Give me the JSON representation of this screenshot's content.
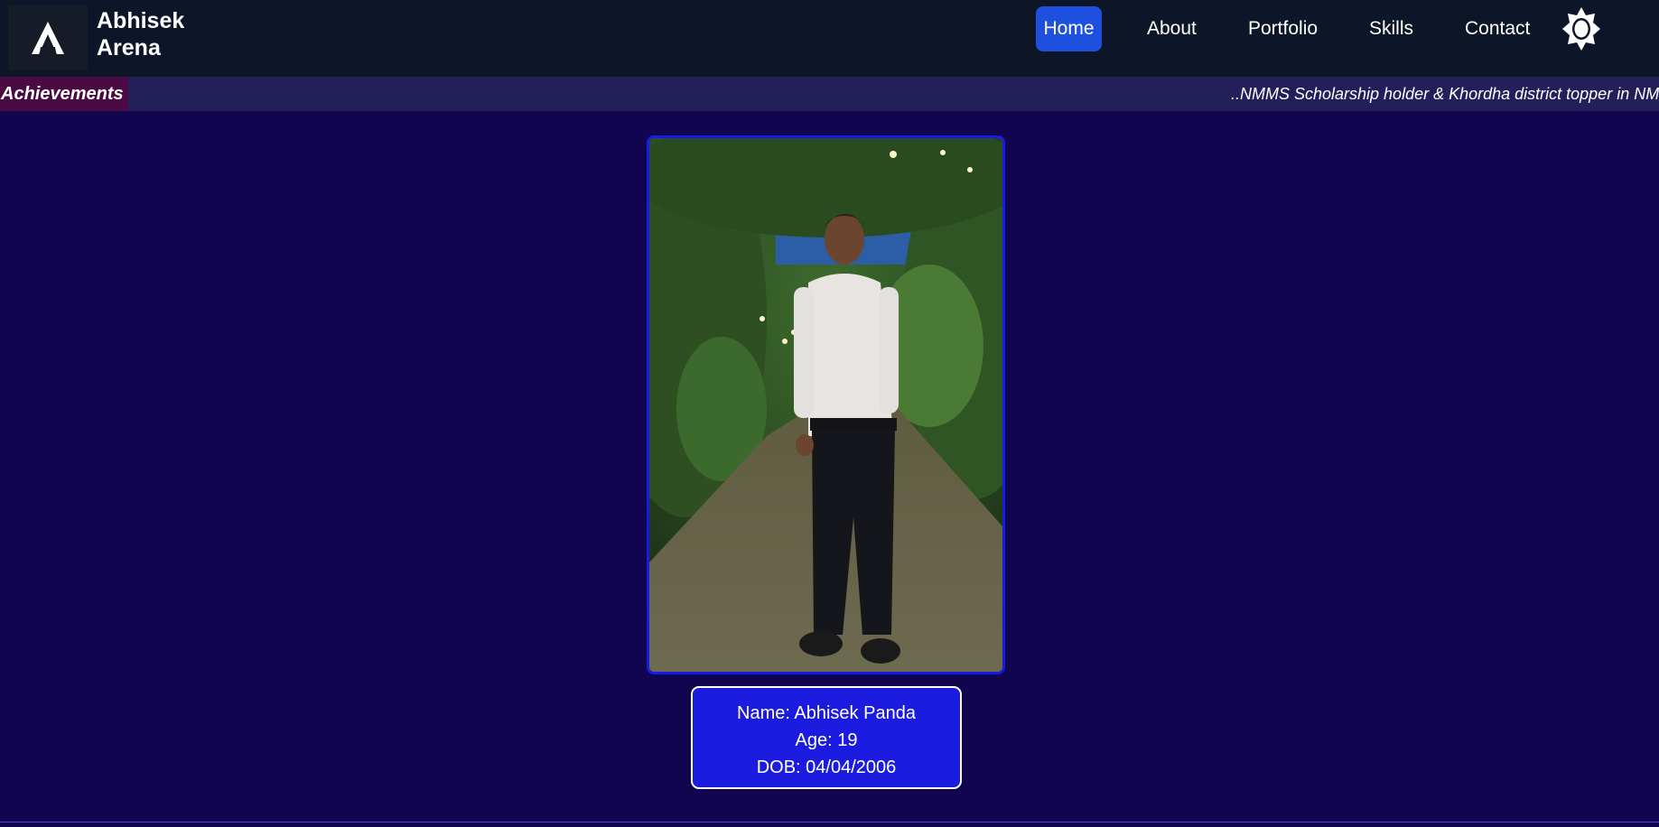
{
  "header": {
    "logo_letter": "A",
    "brand_line1": "Abhisek",
    "brand_line2": "Arena",
    "nav": [
      {
        "label": "Home",
        "active": true
      },
      {
        "label": "About"
      },
      {
        "label": "Portfolio"
      },
      {
        "label": "Skills"
      },
      {
        "label": "Contact"
      }
    ],
    "theme_icon": "sun-icon"
  },
  "ticker": {
    "label": "Achievements",
    "text": "..NMMS Scholarship holder & Khordha district topper in NMMS"
  },
  "profile": {
    "photo_icon": "profile-photo",
    "name_line": "Name: Abhisek Panda",
    "age_line": "Age: 19",
    "dob_line": "DOB: 04/04/2006"
  },
  "colors": {
    "page_bg": "#12054f",
    "header_bg": "#0d1628",
    "nav_active": "#1e50e0",
    "ticker_bg": "#231f5a",
    "ticker_label_bg": "#4a0a44",
    "info_box_bg": "#1c1ce0",
    "photo_border": "#1a1ae8"
  }
}
